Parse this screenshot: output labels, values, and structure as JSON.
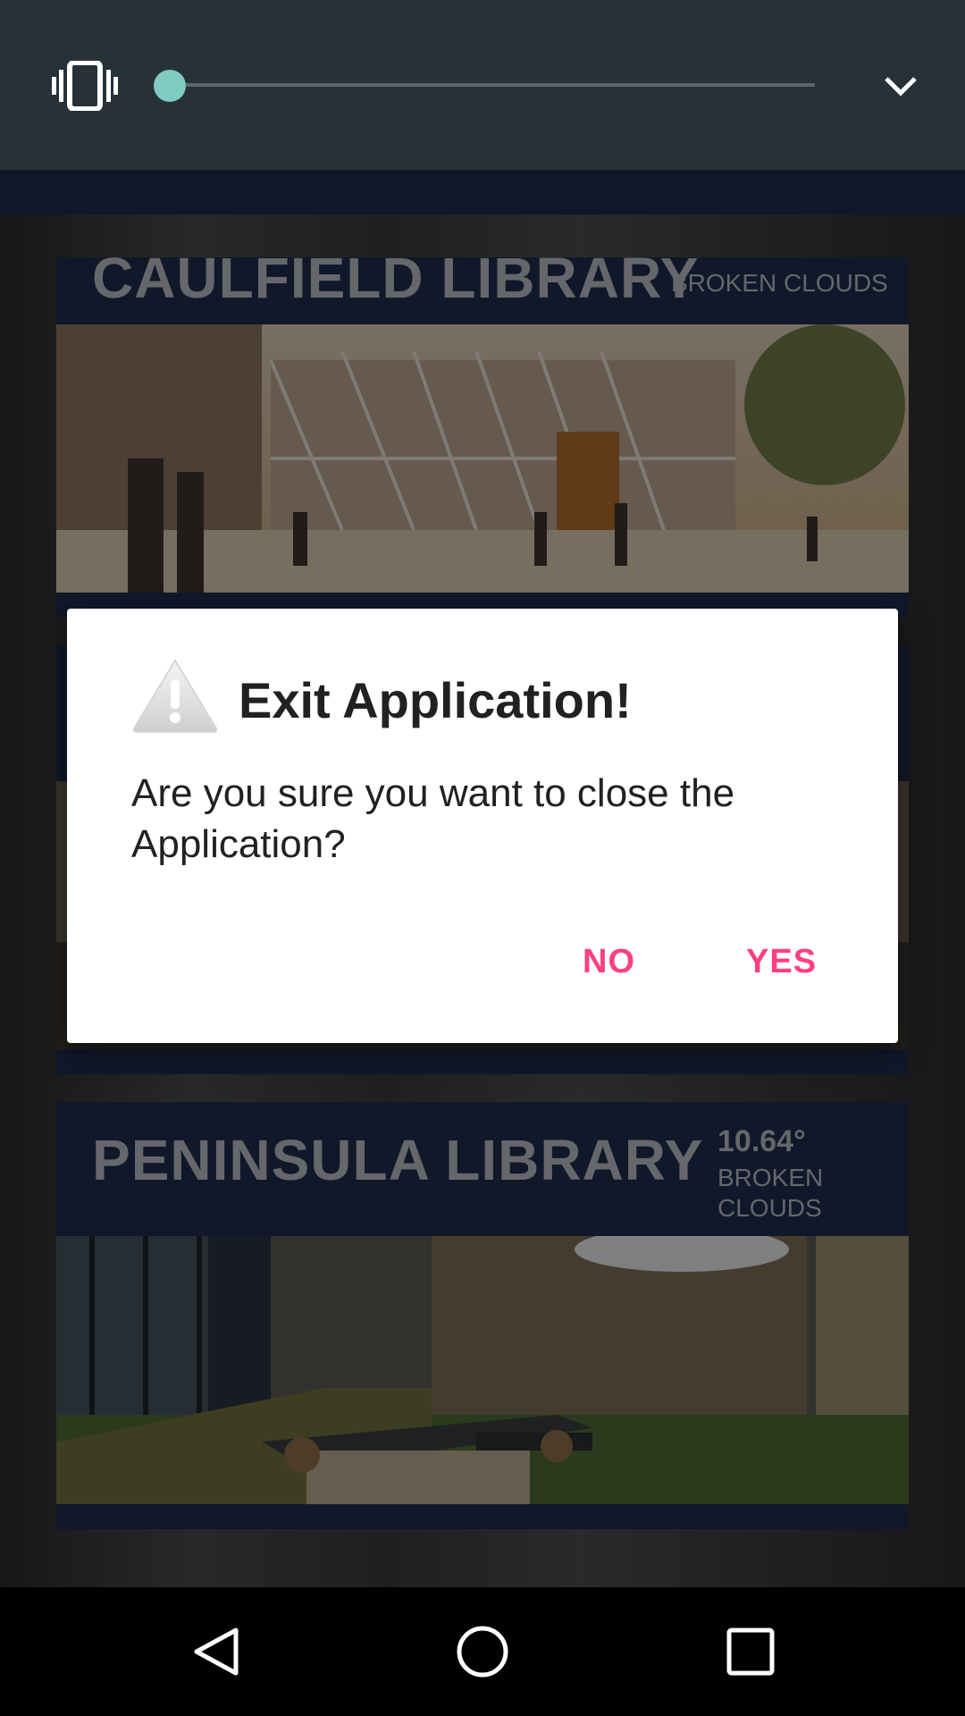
{
  "cards": [
    {
      "title": "CAULFIELD LIBRARY",
      "weather": "BROKEN CLOUDS"
    },
    {
      "title": "PENINSULA LIBRARY",
      "temperature": "10.64°",
      "weather": "BROKEN CLOUDS"
    }
  ],
  "dialog": {
    "title": "Exit Application!",
    "message": "Are you sure you want to close the Application?",
    "no_label": "NO",
    "yes_label": "YES",
    "icon": "warning-icon"
  },
  "volume": {
    "level": 0
  },
  "navbar": {
    "icons": [
      "back-icon",
      "home-icon",
      "recents-icon"
    ]
  },
  "colors": {
    "accent": "#ff4081",
    "card_bg": "#1e2c4e",
    "volume_panel": "#263238",
    "slider_thumb": "#80cbc4"
  }
}
